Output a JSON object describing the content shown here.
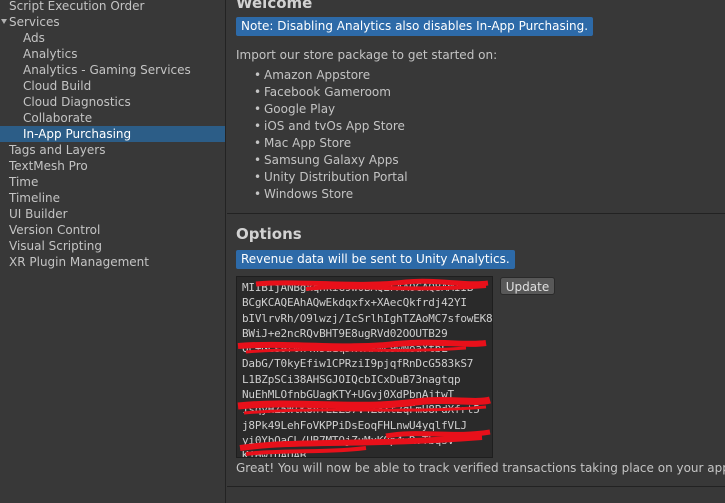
{
  "sidebar": {
    "items": [
      {
        "label": "Script Execution Order",
        "indent": 0,
        "selected": false
      },
      {
        "label": "Services",
        "indent": 0,
        "selected": false,
        "expanded": true
      },
      {
        "label": "Ads",
        "indent": 1,
        "selected": false
      },
      {
        "label": "Analytics",
        "indent": 1,
        "selected": false
      },
      {
        "label": "Analytics - Gaming Services",
        "indent": 1,
        "selected": false
      },
      {
        "label": "Cloud Build",
        "indent": 1,
        "selected": false
      },
      {
        "label": "Cloud Diagnostics",
        "indent": 1,
        "selected": false
      },
      {
        "label": "Collaborate",
        "indent": 1,
        "selected": false
      },
      {
        "label": "In-App Purchasing",
        "indent": 1,
        "selected": true
      },
      {
        "label": "Tags and Layers",
        "indent": 0,
        "selected": false
      },
      {
        "label": "TextMesh Pro",
        "indent": 0,
        "selected": false
      },
      {
        "label": "Time",
        "indent": 0,
        "selected": false
      },
      {
        "label": "Timeline",
        "indent": 0,
        "selected": false
      },
      {
        "label": "UI Builder",
        "indent": 0,
        "selected": false
      },
      {
        "label": "Version Control",
        "indent": 0,
        "selected": false
      },
      {
        "label": "Visual Scripting",
        "indent": 0,
        "selected": false
      },
      {
        "label": "XR Plugin Management",
        "indent": 0,
        "selected": false
      }
    ]
  },
  "welcome": {
    "title": "Welcome",
    "note": "Note: Disabling Analytics also disables In-App Purchasing.",
    "intro": "Import our store package to get started on:",
    "bullet": "•",
    "stores": [
      "Amazon Appstore",
      "Facebook Gameroom",
      "Google Play",
      "iOS and tvOs App Store",
      "Mac App Store",
      "Samsung Galaxy Apps",
      "Unity Distribution Portal",
      "Windows Store"
    ]
  },
  "options": {
    "title": "Options",
    "note": "Revenue data will be sent to Unity Analytics.",
    "key_lines": [
      "MIIBIjANBgkqhkiG9w0BAQEFAAOCAQ8AMIIB",
      "BCgKCAQEAhAQwEkdqxfx+XAecQkfrdj42YI",
      "bIVlrvRh/O9lwzj/IcSrlhIghTZAoMC7sfowEK8",
      "BWiJ+e2ncRQvBHT9E8ugRVd02OOUTB29",
      "Qc+GCs9r0h4W5a1qDNvAPwc9wNoaYtbL",
      "DabG/T0kyEfiw1CPRziI9pjqfRnDcG583kS7",
      "L1BZpSCi38AHSGJOIQcbICxDuB73nagtqp",
      "NuEhMLOfnbGUagKTY+UGvj0XdPbnAjtwT",
      "1sqyHZ5WlK8nfL2ZS7V4Z8Xt2qFmU8PdXfrt5",
      "j8Pk49LehFoVKPPiDsEoqFHLnwU4yqlfVLJ",
      "yi0YbQaCL/UB7MTOjZuMxK0p4wRvTbqsV",
      "KjHwIDAQAB"
    ],
    "update_label": "Update",
    "success": "Great! You will now be able to track verified transactions taking place on your app."
  },
  "colors": {
    "background": "#383838",
    "selected": "#2c5d87",
    "note_blue": "#2d6aa8",
    "redaction": "#e8101a"
  }
}
